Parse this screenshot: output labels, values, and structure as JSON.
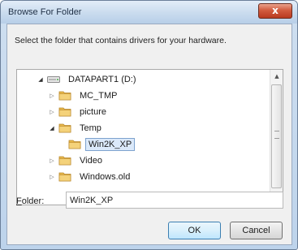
{
  "window": {
    "title": "Browse For Folder",
    "close_glyph": "x"
  },
  "dialog": {
    "instruction": "Select the folder that contains drivers for your hardware.",
    "tree": [
      {
        "label": "DATAPART1 (D:)",
        "icon": "drive-icon",
        "expanded": true,
        "has_children": true,
        "level": 0,
        "selected": false
      },
      {
        "label": "MC_TMP",
        "icon": "folder-icon",
        "expanded": false,
        "has_children": true,
        "level": 1,
        "selected": false
      },
      {
        "label": "picture",
        "icon": "folder-icon",
        "expanded": false,
        "has_children": true,
        "level": 1,
        "selected": false
      },
      {
        "label": "Temp",
        "icon": "folder-icon",
        "expanded": true,
        "has_children": true,
        "level": 1,
        "selected": false
      },
      {
        "label": "Win2K_XP",
        "icon": "folder-icon",
        "expanded": false,
        "has_children": false,
        "level": 2,
        "selected": true
      },
      {
        "label": "Video",
        "icon": "folder-icon",
        "expanded": false,
        "has_children": true,
        "level": 1,
        "selected": false
      },
      {
        "label": "Windows.old",
        "icon": "folder-icon",
        "expanded": false,
        "has_children": true,
        "level": 1,
        "selected": false
      }
    ],
    "folder_label_prefix": "F",
    "folder_label_rest": "older:",
    "folder_value": "Win2K_XP",
    "ok_label": "OK",
    "cancel_label": "Cancel"
  },
  "colors": {
    "folder": "#e8b84a",
    "selection": "#dbe9fa",
    "close_button": "#c9472b"
  }
}
